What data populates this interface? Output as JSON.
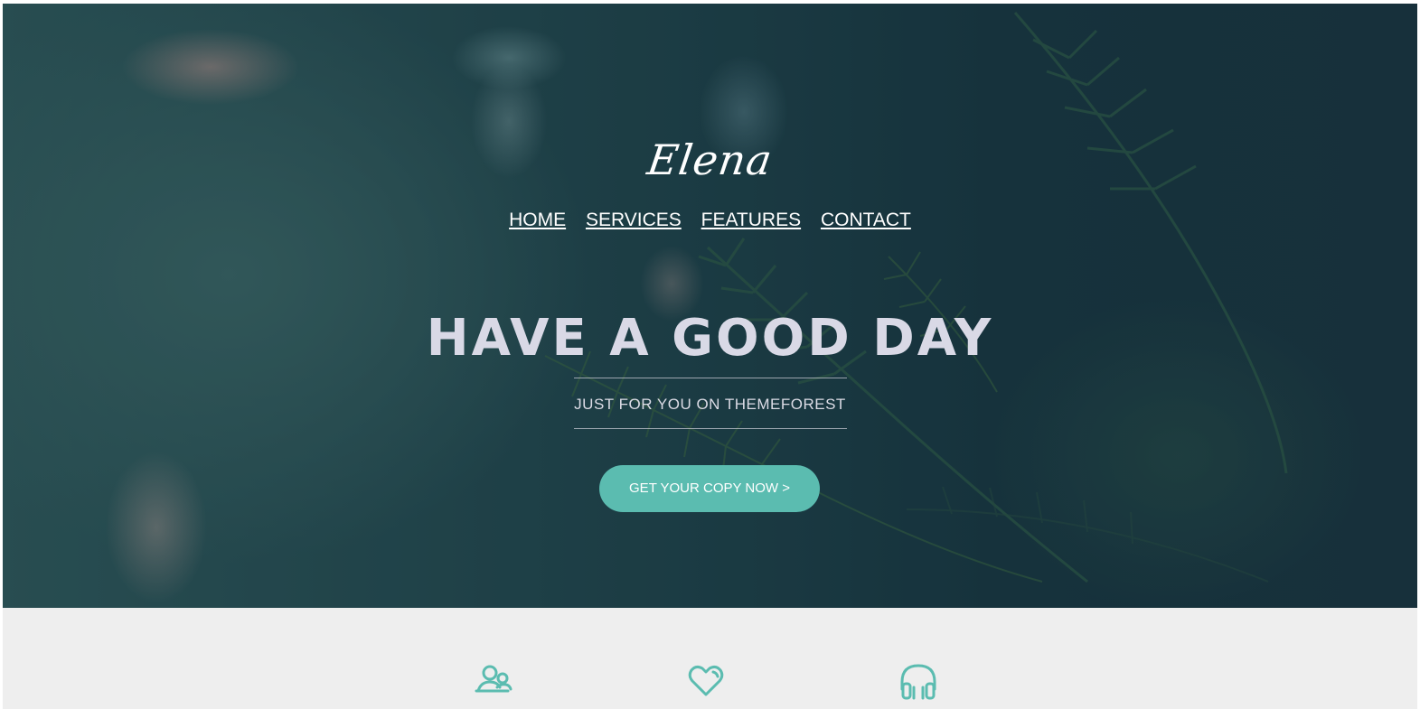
{
  "brand": {
    "logo": "Elena"
  },
  "nav": {
    "items": [
      {
        "label": "HOME"
      },
      {
        "label": "SERVICES"
      },
      {
        "label": "FEATURES"
      },
      {
        "label": "CONTACT"
      }
    ]
  },
  "hero": {
    "headline": "HAVE A GOOD DAY",
    "subline": "JUST FOR YOU ON THEMEFOREST",
    "cta_label": "GET YOUR COPY NOW >"
  },
  "features": {
    "icons": [
      "users-icon",
      "heart-icon",
      "headphones-icon"
    ]
  },
  "colors": {
    "accent": "#5bbcb0",
    "features_bg": "#eeeeee",
    "headline": "#d9d9e6"
  }
}
